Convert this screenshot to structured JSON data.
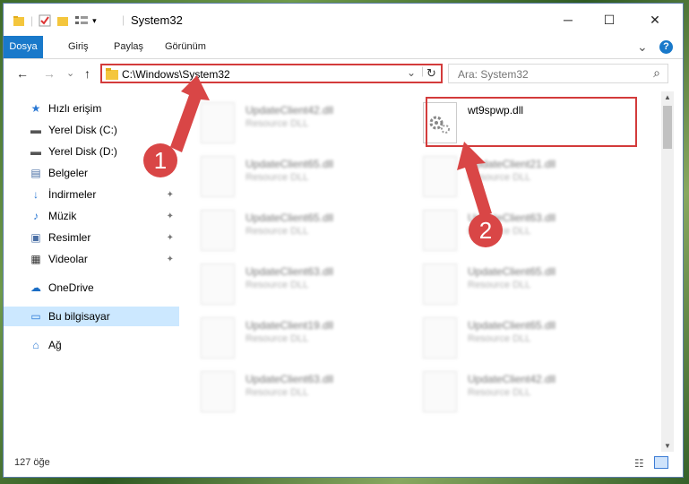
{
  "titlebar": {
    "title": "System32",
    "minimize": "─",
    "maximize": "☐",
    "close": "✕"
  },
  "ribbon": {
    "tabs": [
      "Dosya",
      "Giriş",
      "Paylaş",
      "Görünüm"
    ],
    "collapse_icon": "⌄",
    "help_icon": "?"
  },
  "nav": {
    "back": "←",
    "forward": "→",
    "dropdown": "⌄",
    "up": "↑",
    "address": "C:\\Windows\\System32",
    "address_dropdown": "⌄",
    "refresh": "↻",
    "search_placeholder": "Ara: System32",
    "search_icon": "⌕"
  },
  "sidebar": {
    "items": [
      {
        "label": "Hızlı erişim",
        "icon": "★"
      },
      {
        "label": "Yerel Disk (C:)",
        "icon": "▬"
      },
      {
        "label": "Yerel Disk (D:)",
        "icon": "▬"
      },
      {
        "label": "Belgeler",
        "icon": "▤"
      },
      {
        "label": "İndirmeler",
        "icon": "↓"
      },
      {
        "label": "Müzik",
        "icon": "♪"
      },
      {
        "label": "Resimler",
        "icon": "▣"
      },
      {
        "label": "Videolar",
        "icon": "▦"
      },
      {
        "label": "OneDrive",
        "icon": "☁"
      },
      {
        "label": "Bu bilgisayar",
        "icon": "▭"
      },
      {
        "label": "Ağ",
        "icon": "⌂"
      }
    ],
    "pin": "📌"
  },
  "files": {
    "left": [
      {
        "name": "UpdateClient42.dll",
        "type": "Resource DLL"
      },
      {
        "name": "UpdateClient65.dll",
        "type": "Resource DLL"
      },
      {
        "name": "UpdateClient65.dll",
        "type": "Resource DLL"
      },
      {
        "name": "UpdateClient63.dll",
        "type": "Resource DLL"
      },
      {
        "name": "UpdateClient19.dll",
        "type": "Resource DLL"
      },
      {
        "name": "UpdateClient63.dll",
        "type": "Resource DLL"
      }
    ],
    "right": [
      {
        "name": "wt9spwp.dll",
        "type": ""
      },
      {
        "name": "UpdateClient21.dll",
        "type": "Resource DLL"
      },
      {
        "name": "UpdateClient63.dll",
        "type": "Resource DLL"
      },
      {
        "name": "UpdateClient65.dll",
        "type": "Resource DLL"
      },
      {
        "name": "UpdateClient65.dll",
        "type": "Resource DLL"
      },
      {
        "name": "UpdateClient42.dll",
        "type": "Resource DLL"
      }
    ]
  },
  "status": {
    "count": "127 öğe"
  },
  "annotations": {
    "badge1": "1",
    "badge2": "2",
    "color": "#d94646"
  }
}
